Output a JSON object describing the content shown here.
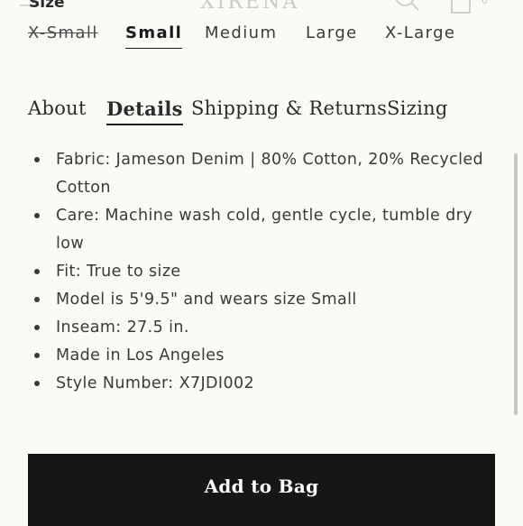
{
  "header": {
    "brand": "XIRENA",
    "bag_count": "0"
  },
  "size": {
    "label": "Size",
    "options": [
      {
        "label": "X-Small",
        "state": "unavailable"
      },
      {
        "label": "Small",
        "state": "selected"
      },
      {
        "label": "Medium",
        "state": "available"
      },
      {
        "label": "Large",
        "state": "available"
      },
      {
        "label": "X-Large",
        "state": "available"
      }
    ]
  },
  "tabs": [
    {
      "label": "About",
      "active": false
    },
    {
      "label": "Details",
      "active": true
    },
    {
      "label": "Shipping & Returns",
      "active": false
    },
    {
      "label": "Sizing",
      "active": false
    }
  ],
  "details": [
    "Fabric: Jameson Denim | 80% Cotton, 20% Recycled Cotton",
    "Care: Machine wash cold, gentle cycle, tumble dry low",
    "Fit: True to size",
    "Model is 5'9.5\" and wears size Small",
    "Inseam: 27.5 in.",
    "Made in Los Angeles",
    "Style Number: X7JDI002"
  ],
  "cta": {
    "add_to_bag": "Add to Bag"
  },
  "icons": {
    "menu": "menu-icon",
    "search": "search-icon",
    "bag": "shopping-bag-icon"
  },
  "colors": {
    "background": "#fbfaf6",
    "text": "#2b2b2b",
    "button": "#161616"
  }
}
